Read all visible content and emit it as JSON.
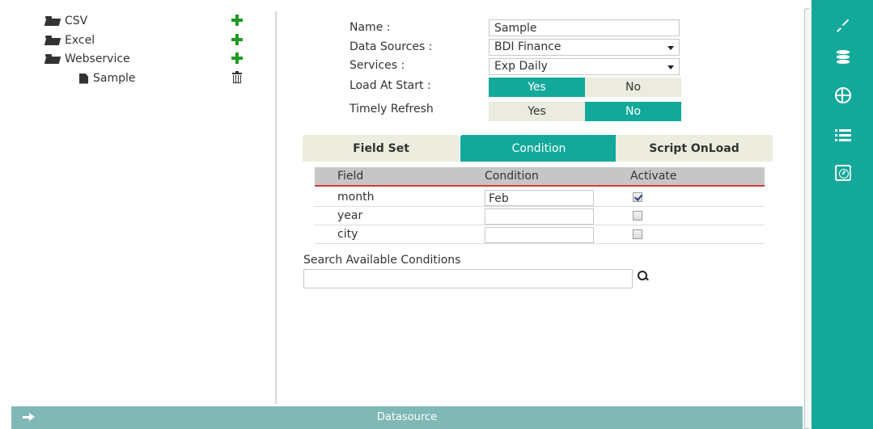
{
  "tree": {
    "items": [
      {
        "label": "CSV",
        "icon": "folder-open-icon",
        "action_icon": "add-icon"
      },
      {
        "label": "Excel",
        "icon": "folder-open-icon",
        "action_icon": "add-icon"
      },
      {
        "label": "Webservice",
        "icon": "folder-open-icon",
        "action_icon": "add-icon"
      },
      {
        "label": "Sample",
        "icon": "file-icon",
        "action_icon": "trash-icon"
      }
    ]
  },
  "form": {
    "name_label": "Name :",
    "name_value": "Sample",
    "datasources_label": "Data Sources :",
    "datasources_value": "BDI Finance",
    "services_label": "Services :",
    "services_value": "Exp Daily",
    "load_at_start_label": "Load At Start :",
    "timely_refresh_label": "Timely Refresh",
    "yes_label": "Yes",
    "no_label": "No",
    "load_at_start_selected": "Yes",
    "timely_refresh_selected": "No"
  },
  "tabs": [
    {
      "label": "Field Set",
      "active": false
    },
    {
      "label": "Condition",
      "active": true
    },
    {
      "label": "Script OnLoad",
      "active": false
    }
  ],
  "table": {
    "headers": [
      "Field",
      "Condition",
      "Activate"
    ],
    "rows": [
      {
        "field": "month",
        "condition": "Feb",
        "activate": true
      },
      {
        "field": "year",
        "condition": "",
        "activate": false
      },
      {
        "field": "city",
        "condition": "",
        "activate": false
      }
    ]
  },
  "search": {
    "label": "Search Available Conditions",
    "value": ""
  },
  "bottom_bar": {
    "title": "Datasource"
  },
  "rail": {
    "icons": [
      "expand-icon",
      "database-icon",
      "globe-icon",
      "list-icon",
      "gauge-icon"
    ]
  },
  "colors": {
    "accent": "#12a99a",
    "bottom_bar": "#7fb8b5",
    "add_green": "#1f9a1f"
  }
}
